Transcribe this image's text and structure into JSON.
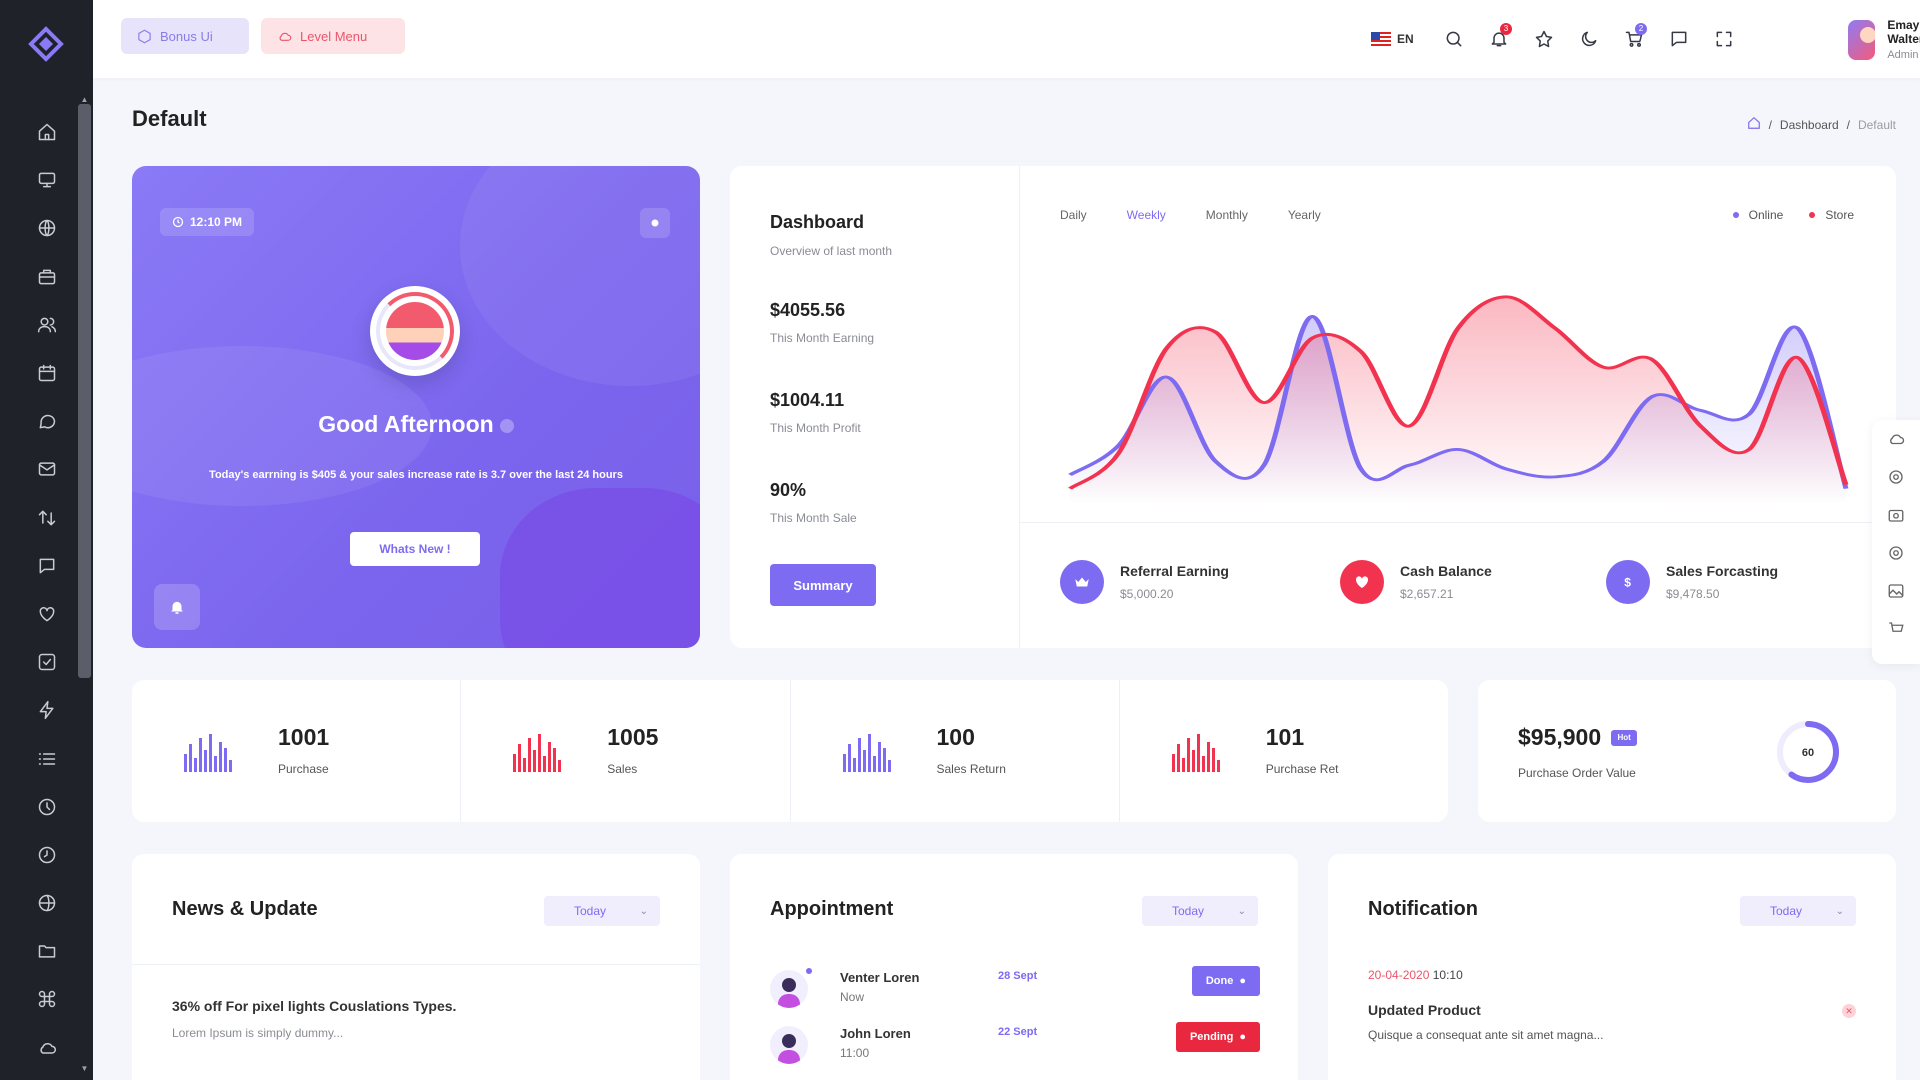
{
  "header": {
    "bonus_label": "Bonus Ui",
    "level_label": "Level Menu",
    "language": "EN",
    "notification_count": "3",
    "cart_count": "2",
    "user_name": "Emay Walter",
    "user_role": "Admin ⌄"
  },
  "page": {
    "title": "Default",
    "breadcrumb": [
      "Dashboard",
      "Default"
    ]
  },
  "welcome": {
    "time": "12:10 PM",
    "greeting": "Good Afternoon",
    "description": "Today's earrning is $405 & your sales increase rate is 3.7 over the last 24 hours",
    "button": "Whats New !"
  },
  "dashboard": {
    "title": "Dashboard",
    "subtitle": "Overview of last month",
    "stats": [
      {
        "value": "$4055.56",
        "label": "This Month Earning"
      },
      {
        "value": "$1004.11",
        "label": "This Month Profit"
      },
      {
        "value": "90%",
        "label": "This Month Sale"
      }
    ],
    "summary_button": "Summary",
    "tabs": [
      "Daily",
      "Weekly",
      "Monthly",
      "Yearly"
    ],
    "active_tab": "Weekly",
    "legend": [
      "Online",
      "Store"
    ],
    "mini": [
      {
        "label": "Referral Earning",
        "value": "$5,000.20",
        "icon": "crown-icon",
        "color": "#7d6bf1"
      },
      {
        "label": "Cash Balance",
        "value": "$2,657.21",
        "icon": "heart-icon",
        "color": "#f2334f"
      },
      {
        "label": "Sales Forcasting",
        "value": "$9,478.50",
        "icon": "dollar-icon",
        "color": "#7d6bf1"
      }
    ]
  },
  "chart_data": {
    "type": "area",
    "title": "",
    "xlabel": "",
    "ylabel": "",
    "series": [
      {
        "name": "Online",
        "color": "#7d6bf1",
        "values": [
          15,
          30,
          65,
          22,
          20,
          96,
          18,
          20,
          28,
          18,
          14,
          22,
          55,
          48,
          46,
          90,
          8
        ]
      },
      {
        "name": "Store",
        "color": "#f2334f",
        "values": [
          8,
          26,
          80,
          88,
          52,
          85,
          78,
          40,
          90,
          106,
          90,
          70,
          74,
          40,
          28,
          75,
          10
        ]
      }
    ],
    "ylim": [
      0,
      120
    ],
    "grid": false,
    "legend_position": "top-right"
  },
  "stats_row": [
    {
      "value": "1001",
      "label": "Purchase",
      "color": "#7d6bf1"
    },
    {
      "value": "1005",
      "label": "Sales",
      "color": "#f2334f"
    },
    {
      "value": "100",
      "label": "Sales Return",
      "color": "#7d6bf1"
    },
    {
      "value": "101",
      "label": "Purchase Ret",
      "color": "#f2334f"
    }
  ],
  "order_value": {
    "amount": "$95,900",
    "tag": "Hot",
    "label": "Purchase Order Value",
    "donut_value": "60",
    "donut_percent": 60
  },
  "news": {
    "title": "News & Update",
    "filter": "Today",
    "item_title": "36% off For pixel lights Couslations Types.",
    "item_sub": "Lorem Ipsum is simply dummy..."
  },
  "appointment": {
    "title": "Appointment",
    "filter": "Today",
    "rows": [
      {
        "name": "Venter Loren",
        "time": "Now",
        "date": "28 Sept",
        "status": "Done",
        "color": "#7d6bf1"
      },
      {
        "name": "John Loren",
        "time": "11:00",
        "date": "22 Sept",
        "status": "Pending",
        "color": "#e9283f"
      }
    ]
  },
  "notification": {
    "title": "Notification",
    "filter": "Today",
    "date": "20-04-2020",
    "time": "10:10",
    "item_title": "Updated Product",
    "item_sub": "Quisque a consequat ante sit amet magna..."
  }
}
